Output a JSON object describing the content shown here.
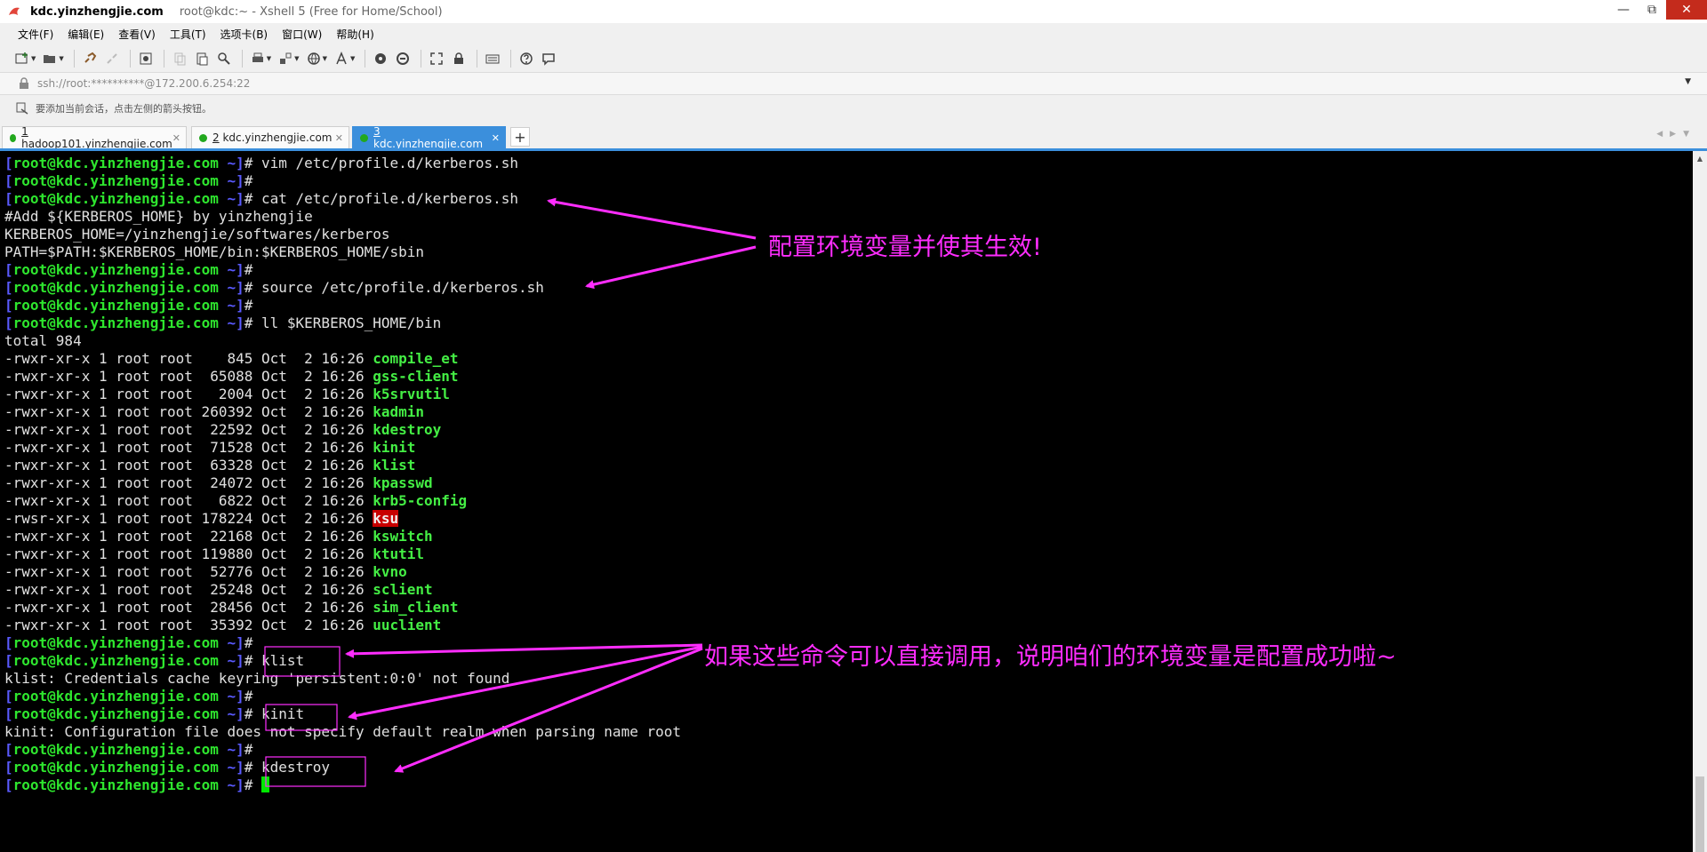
{
  "window": {
    "host": "kdc.yinzhengjie.com",
    "title": "root@kdc:~ - Xshell 5 (Free for Home/School)"
  },
  "menu": [
    "文件(F)",
    "编辑(E)",
    "查看(V)",
    "工具(T)",
    "选项卡(B)",
    "窗口(W)",
    "帮助(H)"
  ],
  "address": "ssh://root:**********@172.200.6.254:22",
  "hint": "要添加当前会话，点击左侧的箭头按钮。",
  "tabs": [
    {
      "num": "1",
      "name": " hadoop101.yinzhengjie.com",
      "active": false
    },
    {
      "num": "2",
      "name": " kdc.yinzhengjie.com",
      "active": false
    },
    {
      "num": "3",
      "name": " kdc.yinzhengjie.com",
      "active": true
    }
  ],
  "prompt": {
    "user": "root",
    "host": "kdc.yinzhengjie.com",
    "dir": "~"
  },
  "terminal": {
    "cmd_vim": "vim /etc/profile.d/kerberos.sh",
    "cmd_cat": "cat /etc/profile.d/kerberos.sh",
    "file_lines": [
      "#Add ${KERBEROS_HOME} by yinzhengjie",
      "KERBEROS_HOME=/yinzhengjie/softwares/kerberos",
      "PATH=$PATH:$KERBEROS_HOME/bin:$KERBEROS_HOME/sbin"
    ],
    "cmd_source": "source /etc/profile.d/kerberos.sh",
    "cmd_ll": "ll $KERBEROS_HOME/bin",
    "total": "total 984",
    "files": [
      {
        "perm": "-rwxr-xr-x 1 root root    845 Oct  2 16:26 ",
        "name": "compile_et"
      },
      {
        "perm": "-rwxr-xr-x 1 root root  65088 Oct  2 16:26 ",
        "name": "gss-client"
      },
      {
        "perm": "-rwxr-xr-x 1 root root   2004 Oct  2 16:26 ",
        "name": "k5srvutil"
      },
      {
        "perm": "-rwxr-xr-x 1 root root 260392 Oct  2 16:26 ",
        "name": "kadmin"
      },
      {
        "perm": "-rwxr-xr-x 1 root root  22592 Oct  2 16:26 ",
        "name": "kdestroy"
      },
      {
        "perm": "-rwxr-xr-x 1 root root  71528 Oct  2 16:26 ",
        "name": "kinit"
      },
      {
        "perm": "-rwxr-xr-x 1 root root  63328 Oct  2 16:26 ",
        "name": "klist"
      },
      {
        "perm": "-rwxr-xr-x 1 root root  24072 Oct  2 16:26 ",
        "name": "kpasswd"
      },
      {
        "perm": "-rwxr-xr-x 1 root root   6822 Oct  2 16:26 ",
        "name": "krb5-config"
      },
      {
        "perm": "-rwsr-xr-x 1 root root 178224 Oct  2 16:26 ",
        "name": "ksu"
      },
      {
        "perm": "-rwxr-xr-x 1 root root  22168 Oct  2 16:26 ",
        "name": "kswitch"
      },
      {
        "perm": "-rwxr-xr-x 1 root root 119880 Oct  2 16:26 ",
        "name": "ktutil"
      },
      {
        "perm": "-rwxr-xr-x 1 root root  52776 Oct  2 16:26 ",
        "name": "kvno"
      },
      {
        "perm": "-rwxr-xr-x 1 root root  25248 Oct  2 16:26 ",
        "name": "sclient"
      },
      {
        "perm": "-rwxr-xr-x 1 root root  28456 Oct  2 16:26 ",
        "name": "sim_client"
      },
      {
        "perm": "-rwxr-xr-x 1 root root  35392 Oct  2 16:26 ",
        "name": "uuclient"
      }
    ],
    "cmd_klist": "klist",
    "out_klist": "klist: Credentials cache keyring 'persistent:0:0' not found",
    "cmd_kinit": "kinit",
    "out_kinit": "kinit: Configuration file does not specify default realm when parsing name root",
    "cmd_kdestroy": "kdestroy"
  },
  "annotations": {
    "note1": "配置环境变量并使其生效!",
    "note2": "如果这些命令可以直接调用，说明咱们的环境变量是配置成功啦~",
    "color": "#ff2dff"
  }
}
